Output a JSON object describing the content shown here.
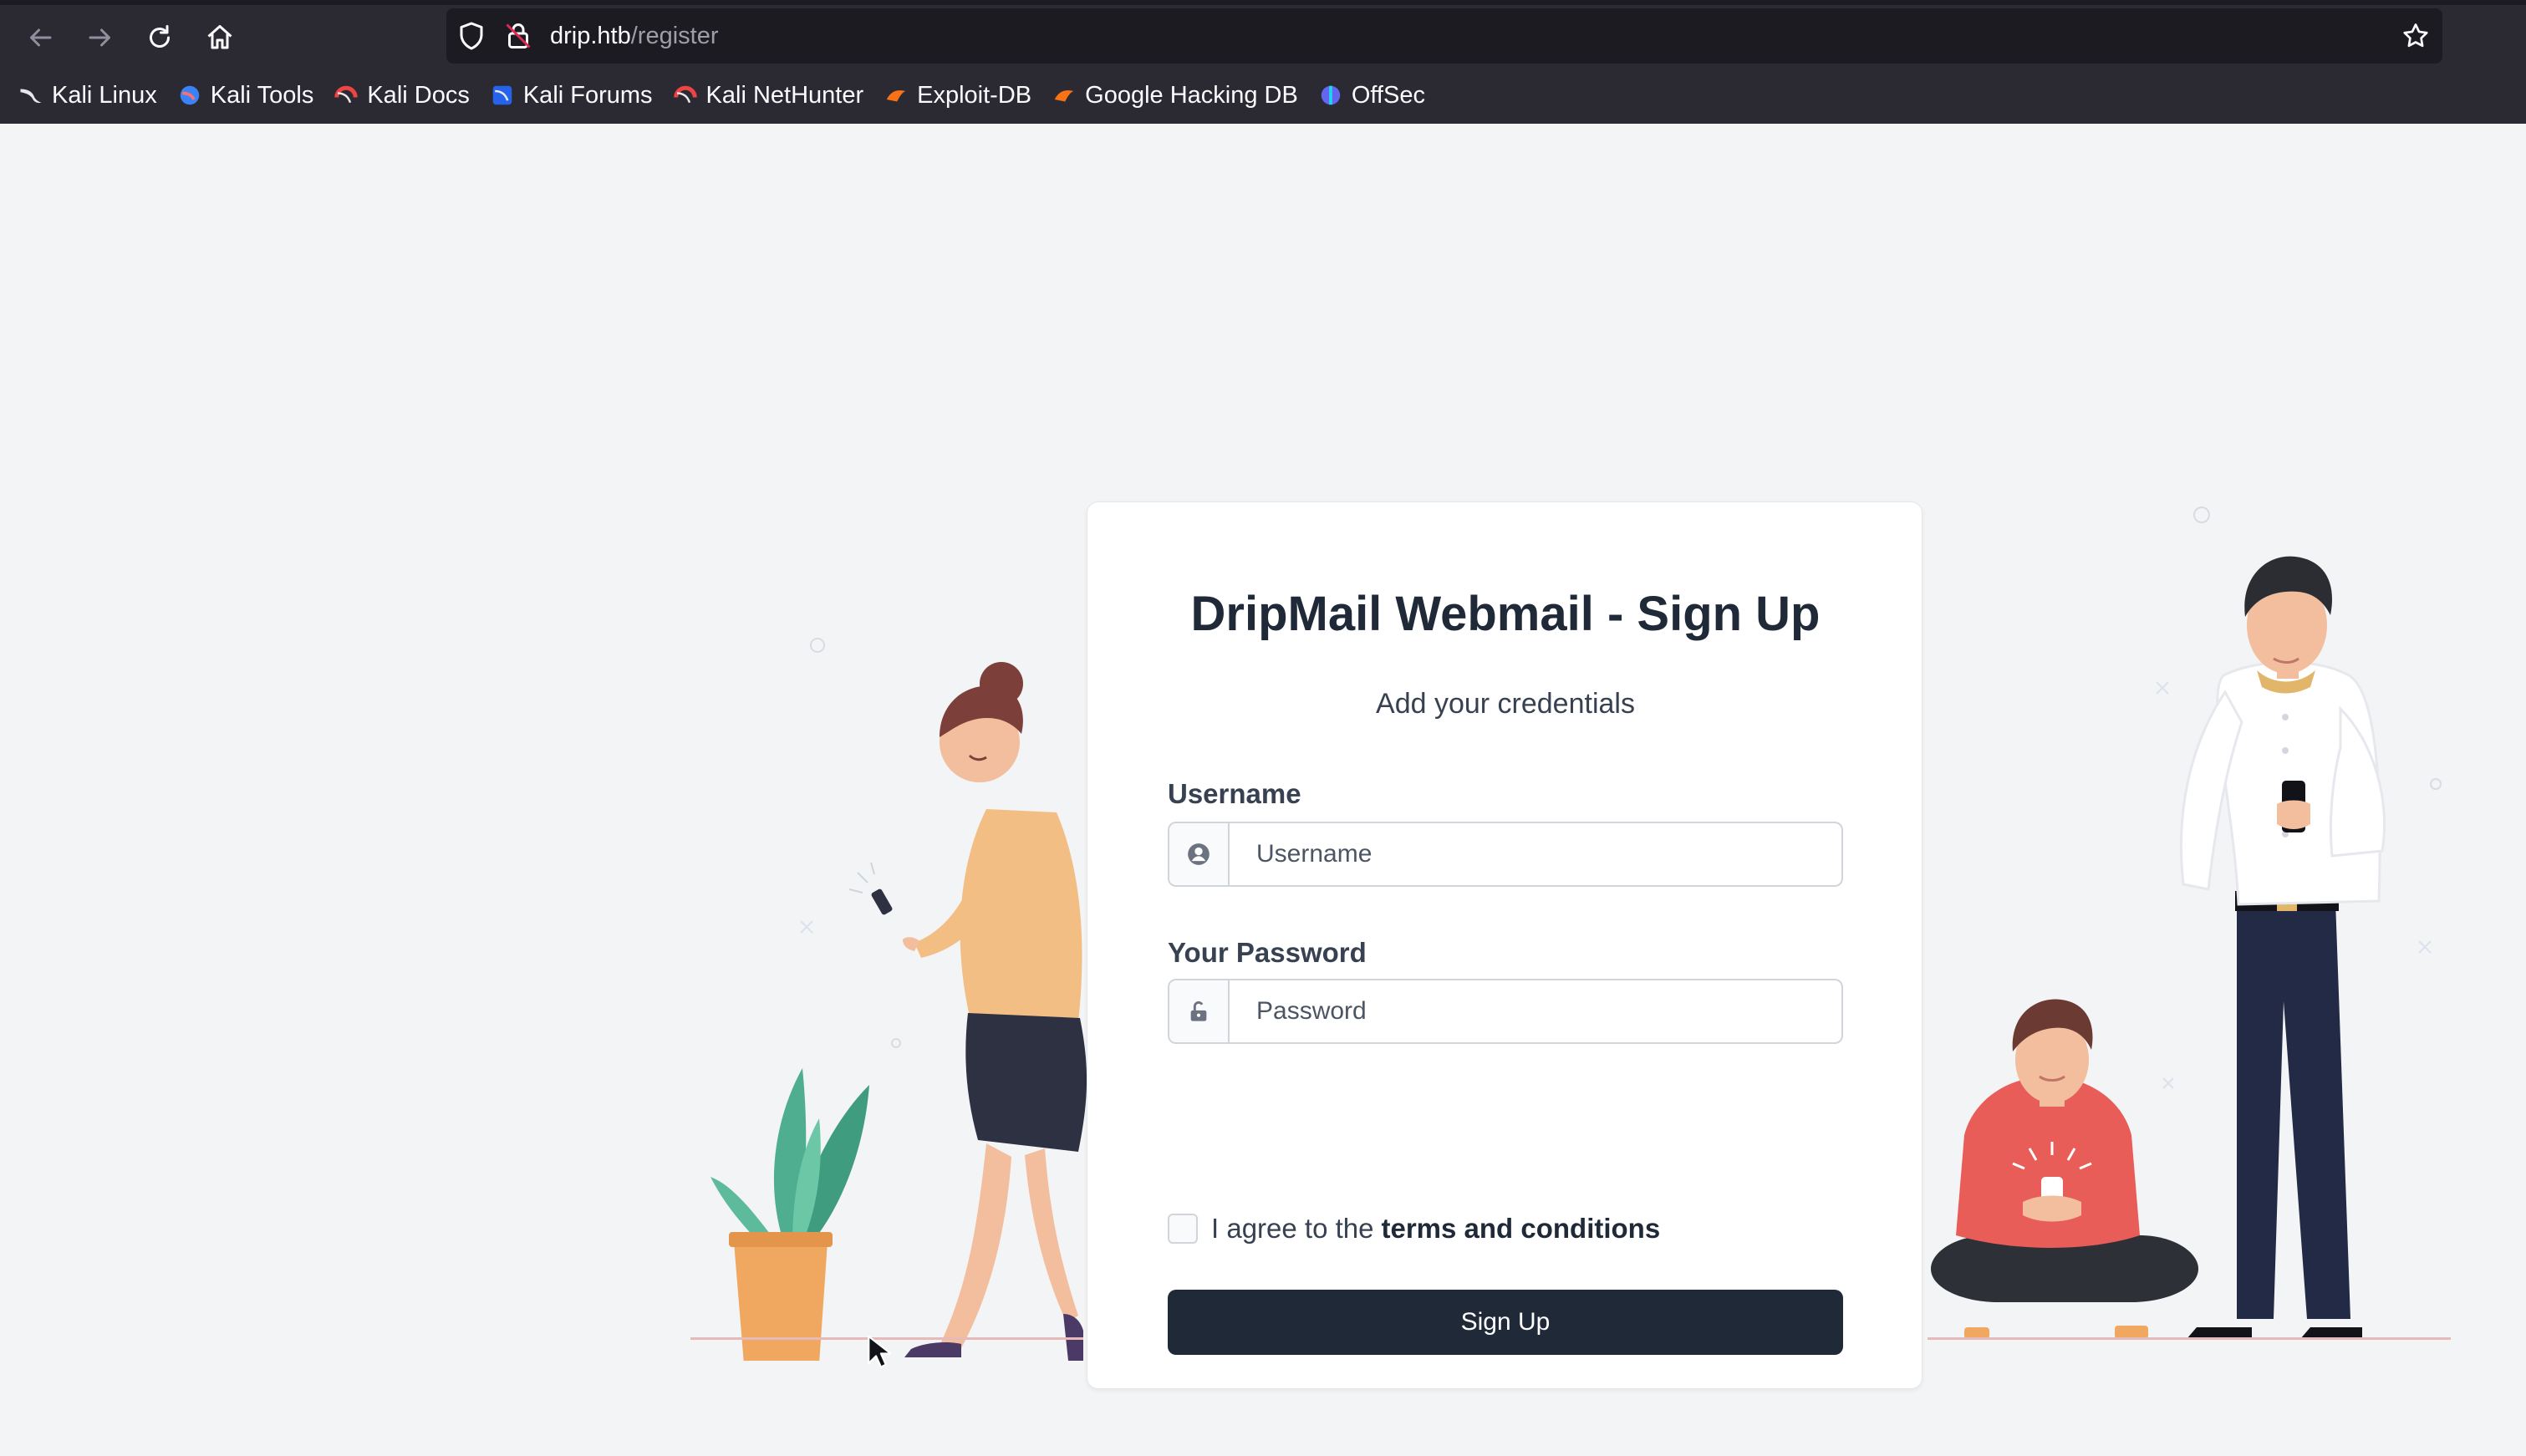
{
  "browser": {
    "url_host": "drip.htb",
    "url_path": "/register",
    "nav": [
      "back-icon",
      "forward-icon",
      "reload-icon",
      "home-icon"
    ],
    "bookmarks": [
      {
        "label": "Kali Linux",
        "icon": "kali-dragon-icon"
      },
      {
        "label": "Kali Tools",
        "icon": "kali-tools-icon"
      },
      {
        "label": "Kali Docs",
        "icon": "kali-docs-icon"
      },
      {
        "label": "Kali Forums",
        "icon": "kali-forums-icon"
      },
      {
        "label": "Kali NetHunter",
        "icon": "kali-nethunter-icon"
      },
      {
        "label": "Exploit-DB",
        "icon": "exploit-db-icon"
      },
      {
        "label": "Google Hacking DB",
        "icon": "ghdb-icon"
      },
      {
        "label": "OffSec",
        "icon": "offsec-icon"
      }
    ]
  },
  "form": {
    "title": "DripMail Webmail - Sign Up",
    "subtitle": "Add your credentials",
    "username_label": "Username",
    "username_placeholder": "Username",
    "username_value": "",
    "password_label": "Your Password",
    "password_placeholder": "Password",
    "password_value": "",
    "terms_prefix": "I agree to the",
    "terms_link": "terms and conditions",
    "terms_checked": false,
    "submit_label": "Sign Up"
  },
  "colors": {
    "chrome_bg": "#2b2a33",
    "page_bg": "#f3f4f6",
    "button_bg": "#1f2937",
    "plant_leaf": "#4fae8f",
    "pot": "#f0a861",
    "woman_shirt": "#f2be84",
    "skirt": "#2d3142",
    "boy_shirt": "#e85d58",
    "man_pants": "#232a45"
  }
}
